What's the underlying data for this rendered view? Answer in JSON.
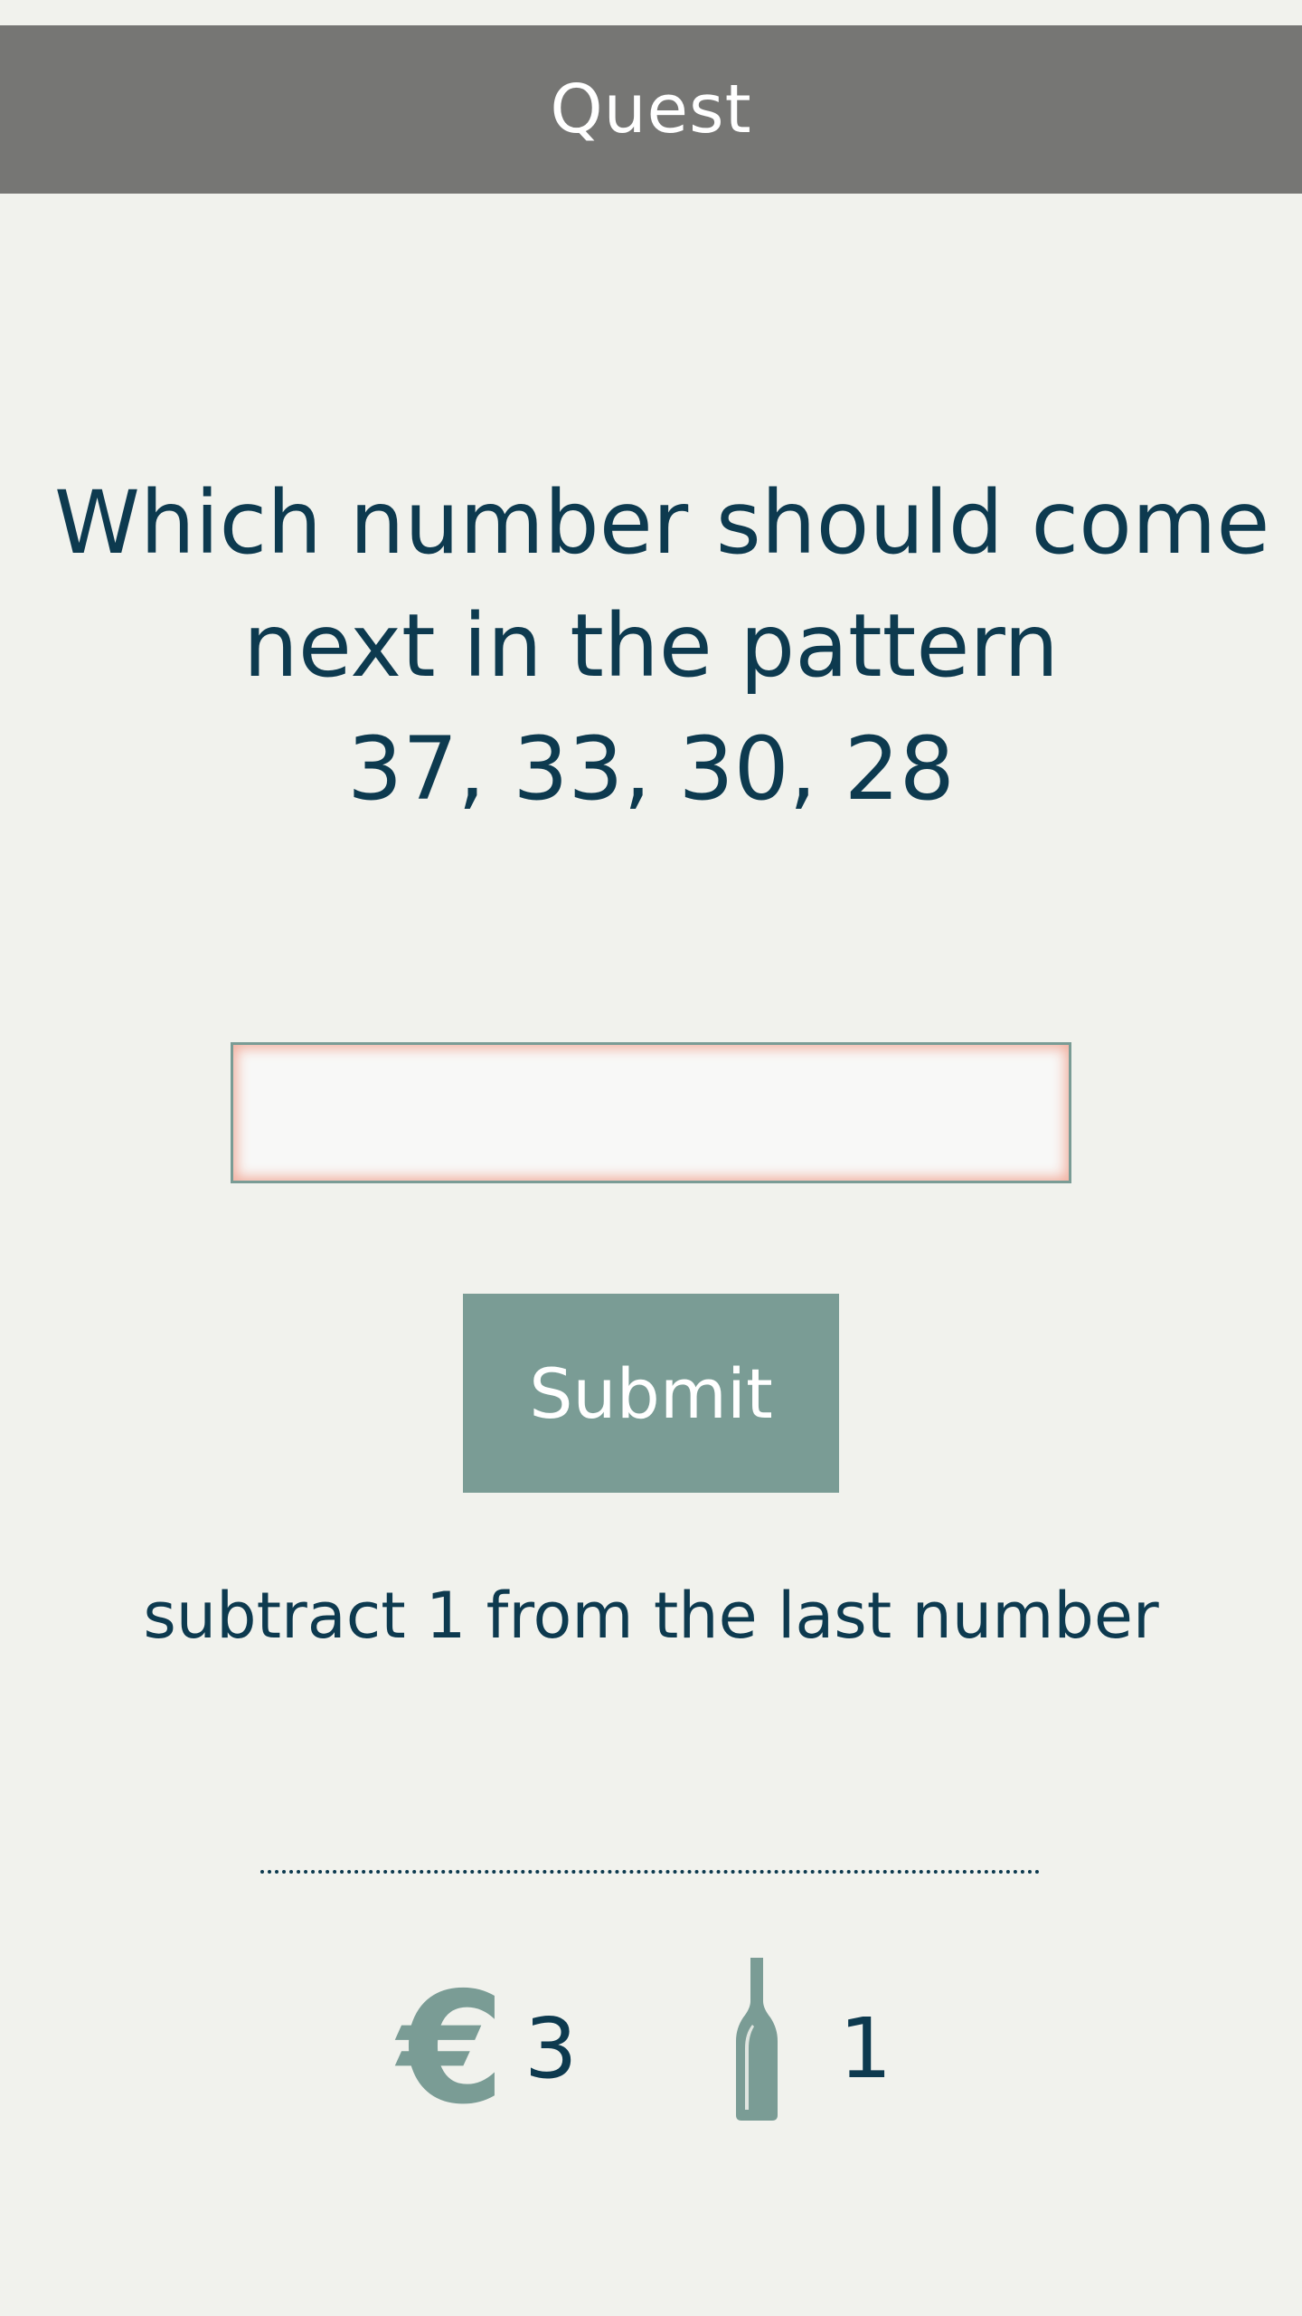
{
  "header": {
    "title": "Quest"
  },
  "question": {
    "line1": "Which number should come",
    "line2": "next in the pattern",
    "line3": "37, 33, 30, 28"
  },
  "answer": {
    "value": "",
    "placeholder": ""
  },
  "submit": {
    "label": "Submit"
  },
  "hint": {
    "text": "subtract 1 from the last number"
  },
  "stats": {
    "coins": {
      "icon": "euro-icon",
      "value": "3"
    },
    "bottles": {
      "icon": "bottle-icon",
      "value": "1"
    }
  },
  "colors": {
    "background": "#f1f2ed",
    "header": "#767674",
    "accent": "#7a9c95",
    "text": "#0d3a4f",
    "input_glow": "#f2b0a0"
  }
}
